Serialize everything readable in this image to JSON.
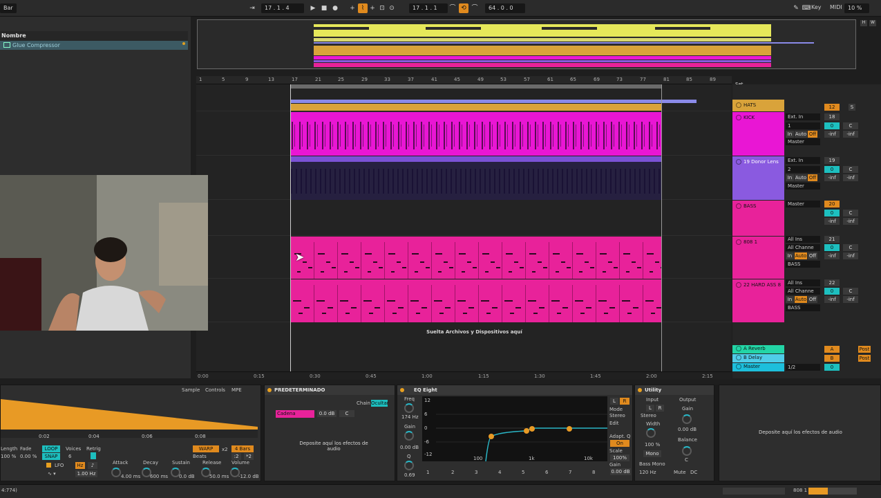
{
  "topbar": {
    "menu_label": "Bar",
    "arrangement_position": "17 .  1 .  4",
    "loop_start": "17 .  1 .  1",
    "loop_length": "64 .  0 .  0",
    "key_label": "Key",
    "midi_label": "MIDI",
    "cpu_label": "10 %",
    "h_label": "H",
    "w_label": "W"
  },
  "browser": {
    "header": "Nombre",
    "selected_item": "Glue Compressor"
  },
  "ruler": {
    "bars": [
      "1",
      "5",
      "9",
      "13",
      "17",
      "21",
      "25",
      "29",
      "33",
      "37",
      "41",
      "45",
      "49",
      "53",
      "57",
      "61",
      "65",
      "69",
      "73",
      "77",
      "81",
      "85",
      "89"
    ],
    "set_label": "Set"
  },
  "timeline": {
    "times": [
      "0:00",
      "0:15",
      "0:30",
      "0:45",
      "1:00",
      "1:15",
      "1:30",
      "1:45",
      "2:00",
      "2:15"
    ]
  },
  "arrangement": {
    "drop_hint": "Suelta Archivos y Dispositivos aquí",
    "clip_numbers": [
      "1",
      "2",
      "3",
      "4",
      "1",
      "2",
      "3",
      "4",
      "1"
    ],
    "marker_label": "1"
  },
  "tracks": [
    {
      "name": "HATS",
      "color": "#d9a33a",
      "input": "",
      "chan": "",
      "volume": "12",
      "extra": "S"
    },
    {
      "name": "KICK",
      "color": "#e916d4",
      "input": "Ext. In",
      "chan": "1",
      "volume": "18",
      "monitor": [
        "In",
        "Auto",
        "Off"
      ],
      "output": "Master",
      "db": [
        "0",
        "C"
      ],
      "vals": [
        "-inf",
        "-inf"
      ]
    },
    {
      "name": "19 Donor Lens",
      "color": "#8a5ae0",
      "input": "Ext. In",
      "chan": "2",
      "volume": "19",
      "monitor": [
        "In",
        "Auto",
        "Off"
      ],
      "output": "Master",
      "db": [
        "0",
        "C"
      ],
      "vals": [
        "-inf",
        "-inf"
      ]
    },
    {
      "name": "BASS",
      "color": "#e8229a",
      "input": "Master",
      "chan": "",
      "volume": "20",
      "db": [
        "0",
        "C"
      ],
      "vals": [
        "-inf",
        "-inf"
      ]
    },
    {
      "name": "808 1",
      "color": "#e8229a",
      "input": "All Ins",
      "chan": "All Channe",
      "volume": "21",
      "monitor": [
        "In",
        "Auto",
        "Off"
      ],
      "output": "BASS",
      "db": [
        "0",
        "C"
      ],
      "vals": [
        "-inf",
        "-inf"
      ]
    },
    {
      "name": "22 HARD ASS 8",
      "color": "#e8229a",
      "input": "All Ins",
      "chan": "All Channe",
      "volume": "22",
      "monitor": [
        "In",
        "Auto",
        "Off"
      ],
      "output": "BASS",
      "db": [
        "0",
        "C"
      ],
      "vals": [
        "-inf",
        "-inf"
      ]
    }
  ],
  "returns": [
    {
      "name": "A Reverb",
      "color": "#23d5a6",
      "letter": "A",
      "post": "Post"
    },
    {
      "name": "B Delay",
      "color": "#4fcde8",
      "letter": "B",
      "post": "Post"
    },
    {
      "name": "Master",
      "color": "#1dbfdc",
      "letter": "1/2",
      "post": "0"
    }
  ],
  "sampler": {
    "tabs": [
      "Sample",
      "Controls",
      "MPE"
    ],
    "labels": [
      "Length",
      "Fade",
      "Voices",
      "Retrig"
    ],
    "fade_value": "0.00 %",
    "length_value": "100 %",
    "voices": "6",
    "loop": "LOOP",
    "snap": "SNAP",
    "warp": "WARP",
    "beats": "Beats",
    "bars": "4 Bars",
    "x2": "x2",
    "div2": ":2",
    "mult2": "*2",
    "lfo_label": "LFO",
    "hz": "1.00 Hz",
    "attack_label": "Attack",
    "attack": "4.00 ms",
    "decay_label": "Decay",
    "decay": "600 ms",
    "sustain_label": "Sustain",
    "sustain": "0.0 dB",
    "release_label": "Release",
    "release": "50.0 ms",
    "volume_label": "Volume",
    "volume": "-12.0 dB",
    "timeline": [
      "0:00",
      "0:02",
      "0:04",
      "0:06",
      "0:08"
    ]
  },
  "rack": {
    "title": "PREDETERMINADO",
    "chain_label": "Chain",
    "hide_label": "Ocultar",
    "chain_name": "Cadena",
    "chain_db": "0.0 dB",
    "chain_pan": "C",
    "drop": "Deposite aquí los efectos de audio"
  },
  "eq": {
    "title": "EQ Eight",
    "freq_label": "Freq",
    "freq": "174 Hz",
    "gain_label": "Gain",
    "gain": "0.00 dB",
    "q_label": "Q",
    "q": "0.69",
    "db_ticks": [
      "12",
      "6",
      "0",
      "-6",
      "-12"
    ],
    "freq_ticks": [
      "100",
      "1k",
      "10k"
    ],
    "mode_label": "Mode",
    "mode": "Stereo",
    "edit_label": "Edit",
    "adapt_label": "Adapt. Q",
    "adapt": "On",
    "scale_label": "Scale",
    "scale": "100%",
    "out_gain_label": "Gain",
    "out_gain": "0.00 dB",
    "bands": [
      "1",
      "2",
      "3",
      "4",
      "5",
      "6",
      "7",
      "8"
    ],
    "lr": "L",
    "rr": "R"
  },
  "utility": {
    "title": "Utility",
    "input_label": "Input",
    "output_label": "Output",
    "gain_label": "Gain",
    "gain": "0.00 dB",
    "stereo": "Stereo",
    "width_label": "Width",
    "width": "100 %",
    "mono": "Mono",
    "balance_label": "Balance",
    "balance": "C",
    "bass_mono": "Bass Mono",
    "bass_hz": "120 Hz",
    "mute": "Mute",
    "dc": "DC",
    "l": "L",
    "r": "R"
  },
  "drop_panel": "Deposite aquí los efectos de audio",
  "status": {
    "left": "4:774)",
    "right": "808 1"
  }
}
